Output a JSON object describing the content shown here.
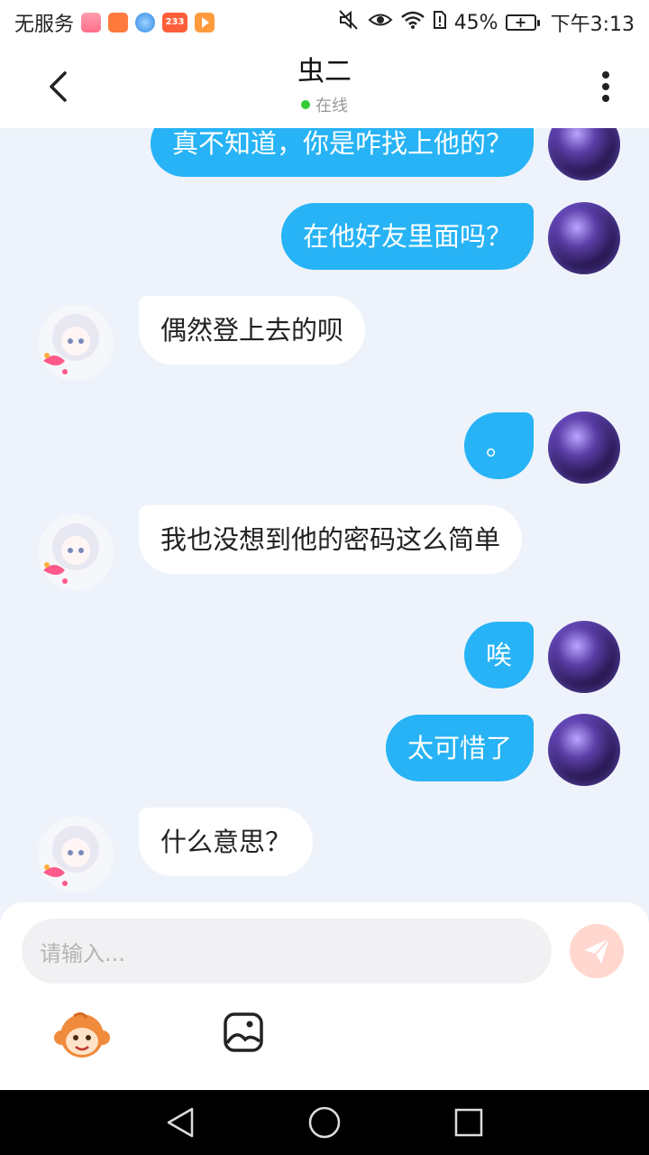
{
  "status_bar": {
    "carrier": "无服务",
    "app_badge_233": "233",
    "battery": "45%",
    "time": "下午3:13",
    "icons": [
      "app-icon-1",
      "app-icon-2",
      "browser-icon",
      "app-233-icon",
      "app-play-icon",
      "mute-icon",
      "eye-icon",
      "wifi-icon",
      "sim-icon",
      "battery-icon"
    ]
  },
  "header": {
    "title": "虫二",
    "status": "在线",
    "status_color": "#33cc33"
  },
  "messages": [
    {
      "side": "out",
      "text": "真不知道，你是咋找上他的？"
    },
    {
      "side": "out",
      "text": "在他好友里面吗？"
    },
    {
      "side": "in",
      "text": "偶然登上去的呗"
    },
    {
      "side": "out",
      "text": "。"
    },
    {
      "side": "in",
      "text": "我也没想到他的密码这么简单"
    },
    {
      "side": "out",
      "text": "唉"
    },
    {
      "side": "out",
      "text": "太可惜了"
    },
    {
      "side": "in",
      "text": "什么意思？"
    }
  ],
  "input": {
    "placeholder": "请输入..."
  },
  "colors": {
    "outgoing_bubble": "#27b3f5",
    "incoming_bubble": "#ffffff",
    "chat_background": "#eef3fb",
    "send_button": "#ffd7cf"
  }
}
